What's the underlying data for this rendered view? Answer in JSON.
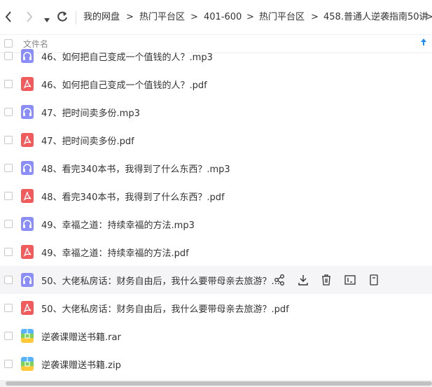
{
  "nav": {
    "back_icon": "chevron-left-icon",
    "forward_icon": "chevron-right-icon",
    "dropdown_icon": "caret-down-icon",
    "refresh_icon": "refresh-icon"
  },
  "breadcrumb": [
    "我的网盘",
    "热门平台区",
    "401-600",
    "热门平台区",
    "458.普通人逆袭指南50讲"
  ],
  "breadcrumb_sep": ">",
  "header": {
    "column_title": "文件名",
    "sort_icon": "arrow-up-icon"
  },
  "files": [
    {
      "name": "46、如何把自己变成一个值钱的人？.mp3",
      "type": "audio"
    },
    {
      "name": "46、如何把自己变成一个值钱的人？.pdf",
      "type": "pdf"
    },
    {
      "name": "47、把时间卖多份.mp3",
      "type": "audio"
    },
    {
      "name": "47、把时间卖多份.pdf",
      "type": "pdf"
    },
    {
      "name": "48、看完340本书，我得到了什么东西？.mp3",
      "type": "audio"
    },
    {
      "name": "48、看完340本书，我得到了什么东西？.pdf",
      "type": "pdf"
    },
    {
      "name": "49、幸福之道：持续幸福的方法.mp3",
      "type": "audio"
    },
    {
      "name": "49、幸福之道：持续幸福的方法.pdf",
      "type": "pdf"
    },
    {
      "name": "50、大佬私房话：财务自由后，我什么要带母亲去旅游？...",
      "type": "audio",
      "hover": true
    },
    {
      "name": "50、大佬私房话：财务自由后，我什么要带母亲去旅游？.pdf",
      "type": "pdf"
    },
    {
      "name": "逆袭课赠送书籍.rar",
      "type": "rar"
    },
    {
      "name": "逆袭课赠送书籍.zip",
      "type": "rar"
    }
  ],
  "row_actions": [
    "share-icon",
    "download-icon",
    "delete-icon",
    "rename-icon",
    "more-icon"
  ],
  "colors": {
    "accent": "#1a8cff",
    "audio_icon": "#8b8ef8",
    "pdf_icon": "#f25b5b"
  }
}
